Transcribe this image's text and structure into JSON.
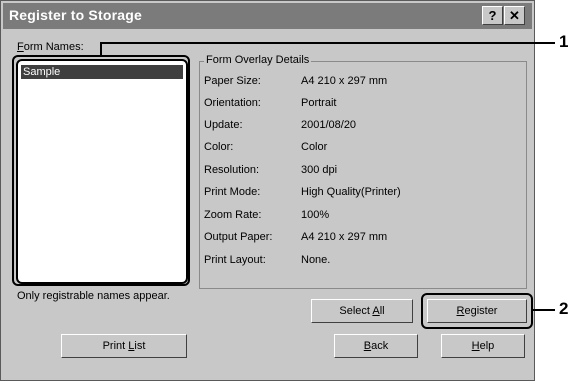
{
  "dialog": {
    "title": "Register to Storage",
    "help_glyph": "?",
    "close_glyph": "✕"
  },
  "form_names": {
    "label_accel": "F",
    "label_rest": "orm Names:",
    "items": [
      "Sample"
    ],
    "note": "Only registrable names appear."
  },
  "details": {
    "title": "Form Overlay Details",
    "rows": [
      {
        "key": "Paper Size:",
        "value": "A4 210 x 297 mm"
      },
      {
        "key": "Orientation:",
        "value": "Portrait"
      },
      {
        "key": "Update:",
        "value": "2001/08/20"
      },
      {
        "key": "Color:",
        "value": "Color"
      },
      {
        "key": "Resolution:",
        "value": "300 dpi"
      },
      {
        "key": "Print Mode:",
        "value": "High Quality(Printer)"
      },
      {
        "key": "Zoom Rate:",
        "value": "100%"
      },
      {
        "key": "Output Paper:",
        "value": "A4 210 x 297 mm"
      },
      {
        "key": "Print Layout:",
        "value": "None."
      }
    ]
  },
  "buttons": {
    "select_all": {
      "pre": "Select ",
      "accel": "A",
      "post": "ll"
    },
    "register": {
      "pre": "",
      "accel": "R",
      "post": "egister"
    },
    "print_list": {
      "pre": "Print ",
      "accel": "L",
      "post": "ist"
    },
    "back": {
      "pre": "",
      "accel": "B",
      "post": "ack"
    },
    "help": {
      "pre": "",
      "accel": "H",
      "post": "elp"
    }
  },
  "callouts": {
    "one": "1",
    "two": "2"
  }
}
